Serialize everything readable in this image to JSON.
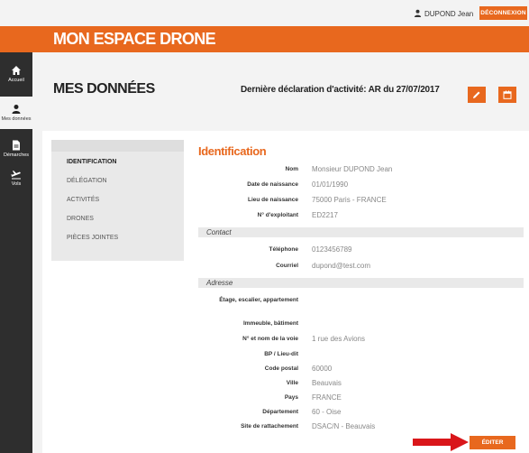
{
  "topbar": {
    "user_name": "DUPOND Jean",
    "logout_label": "DÉCONNEXION"
  },
  "header": {
    "app_title": "MON ESPACE DRONE"
  },
  "sidebar": {
    "items": [
      {
        "label": "Accueil",
        "icon": "home-icon"
      },
      {
        "label": "Mes données",
        "icon": "user-icon"
      },
      {
        "label": "Démarches",
        "icon": "document-icon"
      },
      {
        "label": "Vols",
        "icon": "plane-icon"
      }
    ]
  },
  "page": {
    "title": "MES DONNÉES",
    "last_declaration": "Dernière déclaration d'activité: AR du 27/07/2017"
  },
  "tabs": [
    {
      "label": "IDENTIFICATION"
    },
    {
      "label": "DÉLÉGATION"
    },
    {
      "label": "ACTIVITÉS"
    },
    {
      "label": "DRONES"
    },
    {
      "label": "PIÈCES JOINTES"
    }
  ],
  "section": {
    "title": "Identification",
    "identity": [
      {
        "label": "Nom",
        "value": "Monsieur DUPOND Jean"
      },
      {
        "label": "Date de naissance",
        "value": "01/01/1990"
      },
      {
        "label": "Lieu de naissance",
        "value": "75000 Paris - FRANCE"
      },
      {
        "label": "N° d'exploitant",
        "value": "ED2217"
      }
    ],
    "contact_title": "Contact",
    "contact": [
      {
        "label": "Téléphone",
        "value": "0123456789"
      },
      {
        "label": "Courriel",
        "value": "dupond@test.com"
      }
    ],
    "address_title": "Adresse",
    "address": [
      {
        "label": "Étage, escalier, appartement",
        "value": ""
      },
      {
        "label": "Immeuble, bâtiment",
        "value": ""
      },
      {
        "label": "N° et nom de la voie",
        "value": "1 rue des Avions"
      },
      {
        "label": "BP / Lieu-dit",
        "value": ""
      },
      {
        "label": "Code postal",
        "value": "60000"
      },
      {
        "label": "Ville",
        "value": "Beauvais"
      },
      {
        "label": "Pays",
        "value": "FRANCE"
      },
      {
        "label": "Département",
        "value": "60 - Oise"
      },
      {
        "label": "Site de rattachement",
        "value": "DSAC/N - Beauvais"
      }
    ]
  },
  "actions": {
    "edit_label": "ÉDITER"
  },
  "colors": {
    "accent": "#e8681e",
    "sidebar": "#2e2e2e",
    "arrow": "#d9161a"
  }
}
